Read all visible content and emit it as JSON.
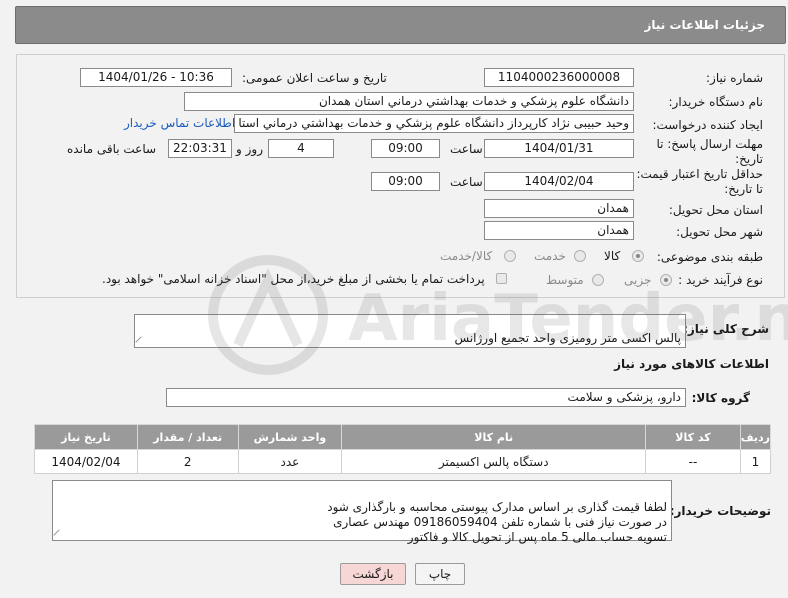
{
  "header": {
    "title": "جزئیات اطلاعات نیاز"
  },
  "form": {
    "need_number_label": "شماره نیاز:",
    "need_number": "1104000236000008",
    "announce_label": "تاریخ و ساعت اعلان عمومی:",
    "announce_value": "1404/01/26 - 10:36",
    "buyer_label": "نام دستگاه خریدار:",
    "buyer_value": "دانشگاه علوم پزشكي و خدمات بهداشتي درماني استان همدان",
    "creator_label": "ایجاد کننده درخواست:",
    "creator_value": "وحید حبیبی نژاد کارپرداز دانشگاه علوم پزشكي و خدمات بهداشتي درماني استا",
    "contact_link": "اطلاعات تماس خریدار",
    "deadline_label_1": "مهلت ارسال پاسخ: تا",
    "deadline_label_2": "تاریخ:",
    "deadline_date": "1404/01/31",
    "time_label": "ساعت",
    "deadline_time": "09:00",
    "days_value": "4",
    "days_label": "روز و",
    "remaining_time": "22:03:31",
    "remaining_label": "ساعت باقی مانده",
    "validity_label_1": "حداقل تاریخ اعتبار قیمت:",
    "validity_label_2": "تا تاریخ:",
    "validity_date": "1404/02/04",
    "validity_time": "09:00",
    "province_label": "استان محل تحویل:",
    "province_value": "همدان",
    "city_label": "شهر محل تحویل:",
    "city_value": "همدان",
    "category_label": "طبقه بندی موضوعی:",
    "category_options": [
      "کالا",
      "خدمت",
      "کالا/خدمت"
    ],
    "process_label": "نوع فرآیند خرید :",
    "process_options": [
      "جزیی",
      "متوسط"
    ],
    "payment_note": "پرداخت تمام یا بخشی از مبلغ خرید،از محل \"اسناد خزانه اسلامی\" خواهد بود."
  },
  "description": {
    "label": "شرح کلی نیاز:",
    "value": "پالس اکسی متر رومیزی واحد تجمیع اورژانس"
  },
  "goods_section": {
    "title": "اطلاعات کالاهای مورد نیاز",
    "group_label": "گروه کالا:",
    "group_value": "دارو، پزشکی و سلامت"
  },
  "table": {
    "headers": [
      "ردیف",
      "کد کالا",
      "نام کالا",
      "واحد شمارش",
      "تعداد / مقدار",
      "تاریخ نیاز"
    ],
    "rows": [
      [
        "1",
        "--",
        "دستگاه پالس اکسیمتر",
        "عدد",
        "2",
        "1404/02/04"
      ]
    ]
  },
  "buyer_notes": {
    "label": "توضیحات خریدار:",
    "value": "لطفا قیمت گذاری بر اساس مدارک پیوستی محاسبه و بارگذاری شود\nدر صورت نیاز فنی با شماره تلفن 09186059404 مهندس عصاری\nتسویه حساب مالی 5 ماه پس از تحویل کالا و فاکتور"
  },
  "buttons": {
    "print": "چاپ",
    "back": "بازگشت"
  },
  "watermark": {
    "text": "AriaTender.neT"
  },
  "colors": {
    "header_bg": "#8b8b8b",
    "link": "#1a5bbf",
    "back_btn_bg": "#f7d6d6"
  }
}
